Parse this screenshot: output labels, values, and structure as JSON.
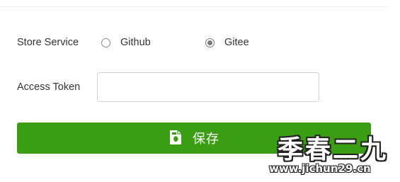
{
  "form": {
    "store_service": {
      "label": "Store Service",
      "options": [
        {
          "label": "Github",
          "checked": false
        },
        {
          "label": "Gitee",
          "checked": true
        }
      ]
    },
    "access_token": {
      "label": "Access Token",
      "value": "",
      "placeholder": ""
    },
    "save_button": {
      "label": "保存",
      "icon": "save-document-icon"
    }
  },
  "watermark": {
    "text": "季春二九",
    "url": "www.jichun29.cn"
  },
  "colors": {
    "primary_button": "#3a9e13",
    "text": "#333333",
    "input_border": "#d3d3d3",
    "radio_checked": "#7a7a7a"
  }
}
